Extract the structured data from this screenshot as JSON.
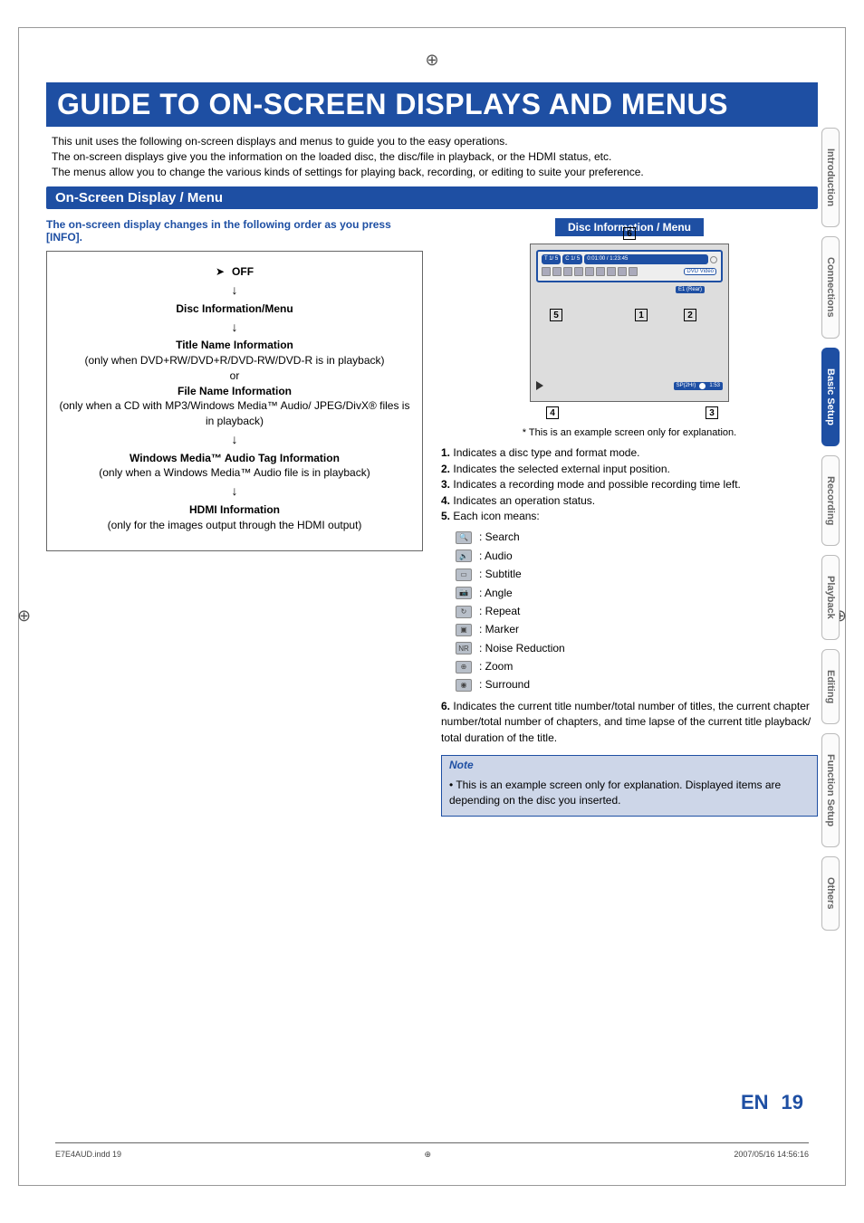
{
  "title": "GUIDE TO ON-SCREEN DISPLAYS AND MENUS",
  "intro_line1": "This unit uses the following on-screen displays and menus to guide you to the easy operations.",
  "intro_line2": "The on-screen displays give you the information on the loaded disc, the disc/file in playback, or the HDMI status, etc.",
  "intro_line3": "The menus allow you to change the various kinds of settings for playing back, recording, or editing to suite your preference.",
  "section_heading": "On-Screen Display / Menu",
  "left_heading": "The on-screen display changes in the following order as you press [INFO].",
  "flow": {
    "off": "OFF",
    "disc_info": "Disc Information/Menu",
    "title_info": "Title Name Information",
    "title_paren": "(only when DVD+RW/DVD+R/DVD-RW/DVD-R is in playback)",
    "or": "or",
    "file_info": "File Name Information",
    "file_paren": "(only when a CD with MP3/Windows Media™ Audio/ JPEG/DivX® files is in playback)",
    "wma_tag": "Windows Media™ Audio Tag Information",
    "wma_paren": "(only when a Windows Media™ Audio file is in playback)",
    "hdmi": "HDMI Information",
    "hdmi_paren": "(only for the images output through the HDMI output)"
  },
  "right_heading": "Disc Information / Menu",
  "screen": {
    "title_counter": "T  1/  5",
    "chapter_counter": "C  1/  5",
    "time": "0:01:00 / 1:23:45",
    "dvd_badge": "DVD Video",
    "e1": "E1 (Rear)",
    "sp": "SP(2Hr)",
    "remain": "1:53"
  },
  "caption": "* This is an example screen only for explanation.",
  "explain": {
    "1": "Indicates a disc type and format mode.",
    "2": "Indicates the selected external input position.",
    "3": "Indicates a recording mode and possible recording time left.",
    "4": "Indicates an operation status.",
    "5": "Each icon means:",
    "6": "Indicates the current title number/total number of titles, the current chapter number/total number of chapters, and time lapse of the current title playback/ total duration of the title."
  },
  "icons": {
    "search": ": Search",
    "audio": ": Audio",
    "subtitle": ": Subtitle",
    "angle": ": Angle",
    "repeat": ": Repeat",
    "marker": ": Marker",
    "nr": ": Noise Reduction",
    "zoom": ": Zoom",
    "surround": ": Surround"
  },
  "note_title": "Note",
  "note_body": "• This is an example screen only for explanation. Displayed items are depending on the disc you inserted.",
  "tabs": [
    "Introduction",
    "Connections",
    "Basic Setup",
    "Recording",
    "Playback",
    "Editing",
    "Function Setup",
    "Others"
  ],
  "active_tab": "Basic Setup",
  "footer_lang": "EN",
  "footer_page": "19",
  "print_file": "E7E4AUD.indd   19",
  "print_time": "2007/05/16   14:56:16"
}
